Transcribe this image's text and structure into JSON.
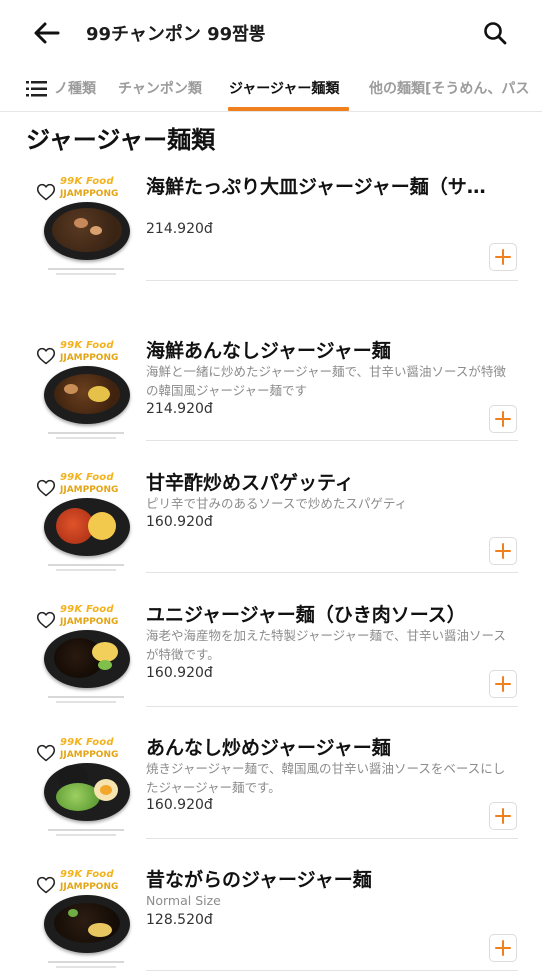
{
  "header": {
    "title": "99チャンポン 99짬뽕"
  },
  "tabs": [
    {
      "label": "ノ種類"
    },
    {
      "label": "チャンポン類"
    },
    {
      "label": "ジャージャー麺類"
    },
    {
      "label": "他の麺類[そうめん、パス"
    }
  ],
  "section": {
    "title": "ジャージャー麺類"
  },
  "thumb_brand": {
    "line1": "99K Food",
    "line2": "JJAMPPONG"
  },
  "items": [
    {
      "name": "海鮮たっぷり大皿ジャージャー麺（サ…",
      "description": "",
      "price": "214.920đ"
    },
    {
      "name": "海鮮あんなしジャージャー麺",
      "description": "海鮮と一緒に炒めたジャージャー麺で、甘辛い醤油ソースが特徴の韓国風ジャージャー麺です",
      "price": "214.920đ"
    },
    {
      "name": "甘辛酢炒めスパゲッティ",
      "description": "ピリ辛で甘みのあるソースで炒めたスパゲティ",
      "price": "160.920đ"
    },
    {
      "name": "ユニジャージャー麺（ひき肉ソース）",
      "description": "海老や海産物を加えた特製ジャージャー麺で、甘辛い醤油ソースが特徴です。",
      "price": "160.920đ"
    },
    {
      "name": "あんなし炒めジャージャー麺",
      "description": "焼きジャージャー麺で、韓国風の甘辛い醤油ソースをベースにしたジャージャー麺です。",
      "price": "160.920đ"
    },
    {
      "name": "昔ながらのジャージャー麺",
      "description": "Normal Size",
      "price": "128.520đ"
    }
  ],
  "colors": {
    "accent": "#f07f1d",
    "brand_yellow": "#f3b21b"
  },
  "icons": {
    "back": "arrow-left-icon",
    "search": "search-icon",
    "menu": "list-menu-icon",
    "favorite": "heart-outline-icon",
    "add": "plus-icon"
  }
}
